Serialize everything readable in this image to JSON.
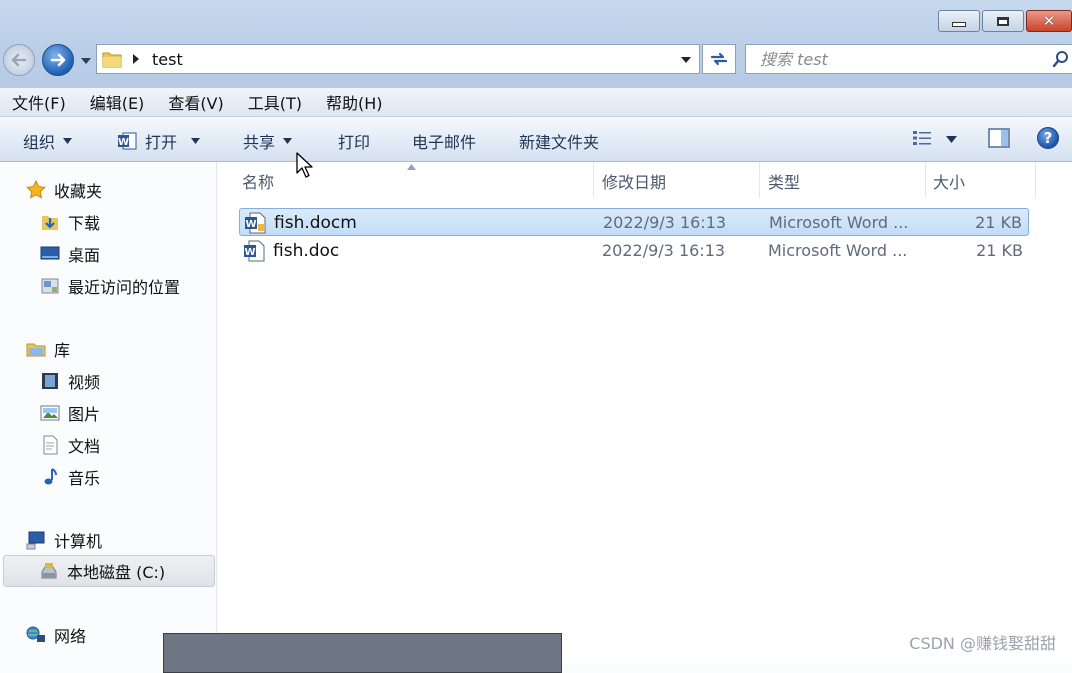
{
  "address": {
    "crumb": "test"
  },
  "search": {
    "placeholder": "搜索 test"
  },
  "menu": [
    "文件(F)",
    "编辑(E)",
    "查看(V)",
    "工具(T)",
    "帮助(H)"
  ],
  "toolbar": {
    "organize": "组织",
    "open": "打开",
    "share": "共享",
    "print": "打印",
    "email": "电子邮件",
    "new_folder": "新建文件夹"
  },
  "nav": {
    "favorites": "收藏夹",
    "downloads": "下载",
    "desktop": "桌面",
    "recent": "最近访问的位置",
    "libraries": "库",
    "videos": "视频",
    "pictures": "图片",
    "documents": "文档",
    "music": "音乐",
    "computer": "计算机",
    "local_disk": "本地磁盘 (C:)",
    "network": "网络"
  },
  "columns": {
    "name": "名称",
    "date": "修改日期",
    "type": "类型",
    "size": "大小"
  },
  "files": [
    {
      "name": "fish.docm",
      "date": "2022/9/3 16:13",
      "type": "Microsoft Word ...",
      "size": "21 KB"
    },
    {
      "name": "fish.doc",
      "date": "2022/9/3 16:13",
      "type": "Microsoft Word ...",
      "size": "21 KB"
    }
  ],
  "watermark": "CSDN @赚钱娶甜甜"
}
